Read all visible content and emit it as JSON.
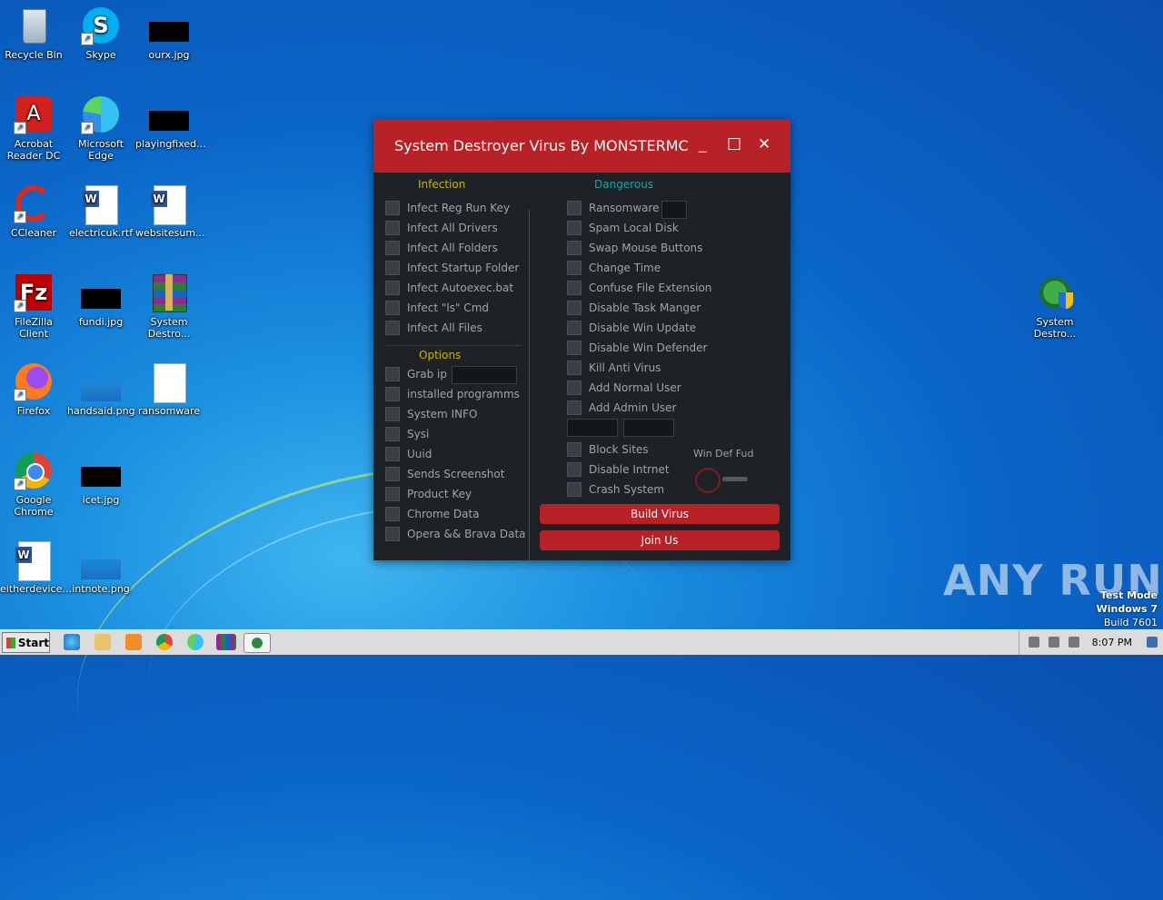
{
  "desktop": {
    "icons": [
      {
        "label": "Recycle Bin"
      },
      {
        "label": "Skype"
      },
      {
        "label": "ourx.jpg"
      },
      {
        "label": "Acrobat Reader DC"
      },
      {
        "label": "Microsoft Edge"
      },
      {
        "label": "playingfixed..."
      },
      {
        "label": "CCleaner"
      },
      {
        "label": "electricuk.rtf"
      },
      {
        "label": "websitesum..."
      },
      {
        "label": "FileZilla Client"
      },
      {
        "label": "fundi.jpg"
      },
      {
        "label": "System Destro..."
      },
      {
        "label": "Firefox"
      },
      {
        "label": "handsaid.png"
      },
      {
        "label": "ransomware"
      },
      {
        "label": "Google Chrome"
      },
      {
        "label": "icet.jpg"
      },
      {
        "label": "eitherdevice..."
      },
      {
        "label": "intnote.png"
      },
      {
        "label": "System Destro..."
      }
    ]
  },
  "window": {
    "title": "System Destroyer Virus By MONSTERMC",
    "minimize": "_",
    "maximize": "□",
    "close": "✕",
    "infection": {
      "heading": "Infection",
      "items": [
        "Infect Reg Run Key",
        "Infect All Drivers",
        "Infect All Folders",
        "Infect Startup Folder",
        "Infect Autoexec.bat",
        "Infect \"ls\" Cmd",
        "Infect All  Files"
      ]
    },
    "options": {
      "heading": "Options",
      "items": [
        "Grab ip",
        "installed programms",
        "System INFO",
        "Sysi",
        "Uuid",
        "Sends Screenshot",
        "Product Key",
        "Chrome Data",
        "Opera && Brava Data"
      ]
    },
    "dangerous": {
      "heading": "Dangerous",
      "items": [
        "Ransomware",
        "Spam Local Disk",
        "Swap Mouse Buttons",
        "Change Time",
        "Confuse File Extension",
        "Disable Task Manger",
        "Disable Win Update",
        "Disable Win Defender",
        "Kill Anti Virus",
        "Add Normal User",
        "Add Admin User"
      ],
      "items2": [
        "Block Sites",
        "Disable Intrnet",
        "Crash System"
      ]
    },
    "win_def_fud": "Win Def Fud",
    "build_button": "Build Virus",
    "join_button": "Join Us"
  },
  "watermark": {
    "brand": "ANY RUN",
    "line1": "Test Mode",
    "line2": "Windows 7",
    "line3": "Build 7601"
  },
  "taskbar": {
    "start": "Start",
    "clock": "8:07 PM"
  }
}
